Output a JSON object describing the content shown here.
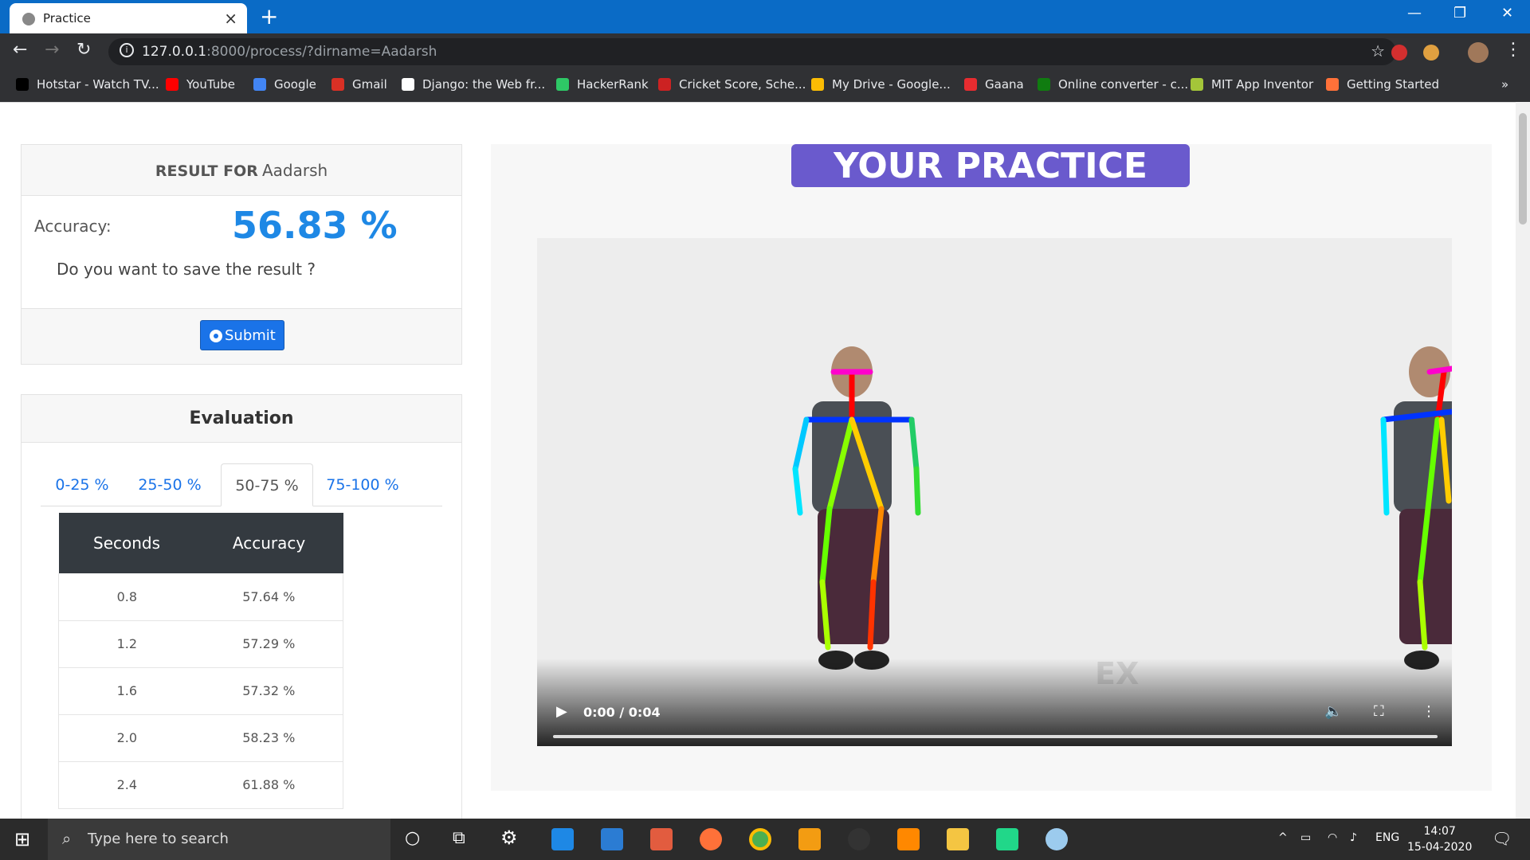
{
  "browser": {
    "tab_title": "Practice",
    "url_host": "127.0.0.1",
    "url_rest": ":8000/process/?dirname=Aadarsh",
    "bookmarks": [
      {
        "label": "Hotstar - Watch TV...",
        "color": "#000000"
      },
      {
        "label": "YouTube",
        "color": "#ff0000"
      },
      {
        "label": "Google",
        "color": "#4285f4"
      },
      {
        "label": "Gmail",
        "color": "#d93025"
      },
      {
        "label": "Django: the Web fr...",
        "color": "#ffffff"
      },
      {
        "label": "HackerRank",
        "color": "#2ec866"
      },
      {
        "label": "Cricket Score, Sche...",
        "color": "#cc2222"
      },
      {
        "label": "My Drive - Google...",
        "color": "#fbbc04"
      },
      {
        "label": "Gaana",
        "color": "#e72c30"
      },
      {
        "label": "Online converter - c...",
        "color": "#107c10"
      },
      {
        "label": "MIT App Inventor",
        "color": "#a4c639"
      },
      {
        "label": "Getting Started",
        "color": "#ff7139"
      }
    ],
    "overflow": "»"
  },
  "result": {
    "heading_bold": "RESULT FOR",
    "name": "Aadarsh",
    "accuracy_label": "Accuracy:",
    "accuracy_value": "56.83 %",
    "question": "Do you want to save the result ?",
    "submit_label": "Submit"
  },
  "evaluation": {
    "title": "Evaluation",
    "tabs": [
      "0-25 %",
      "25-50 %",
      "50-75 %",
      "75-100 %"
    ],
    "active_tab": "50-75 %",
    "columns": [
      "Seconds",
      "Accuracy"
    ],
    "rows": [
      [
        "0.8",
        "57.64 %"
      ],
      [
        "1.2",
        "57.29 %"
      ],
      [
        "1.6",
        "57.32 %"
      ],
      [
        "2.0",
        "58.23 %"
      ],
      [
        "2.4",
        "61.88 %"
      ]
    ]
  },
  "practice": {
    "title": "YOUR PRACTICE",
    "video_time": "0:00 / 0:04",
    "watermark": "EX"
  },
  "taskbar": {
    "search_placeholder": "Type here to search",
    "language": "ENG",
    "time": "14:07",
    "date": "15-04-2020"
  },
  "colors": {
    "accent": "#1e88e5",
    "practice_banner": "#6a5acd",
    "table_header": "#343a40"
  }
}
